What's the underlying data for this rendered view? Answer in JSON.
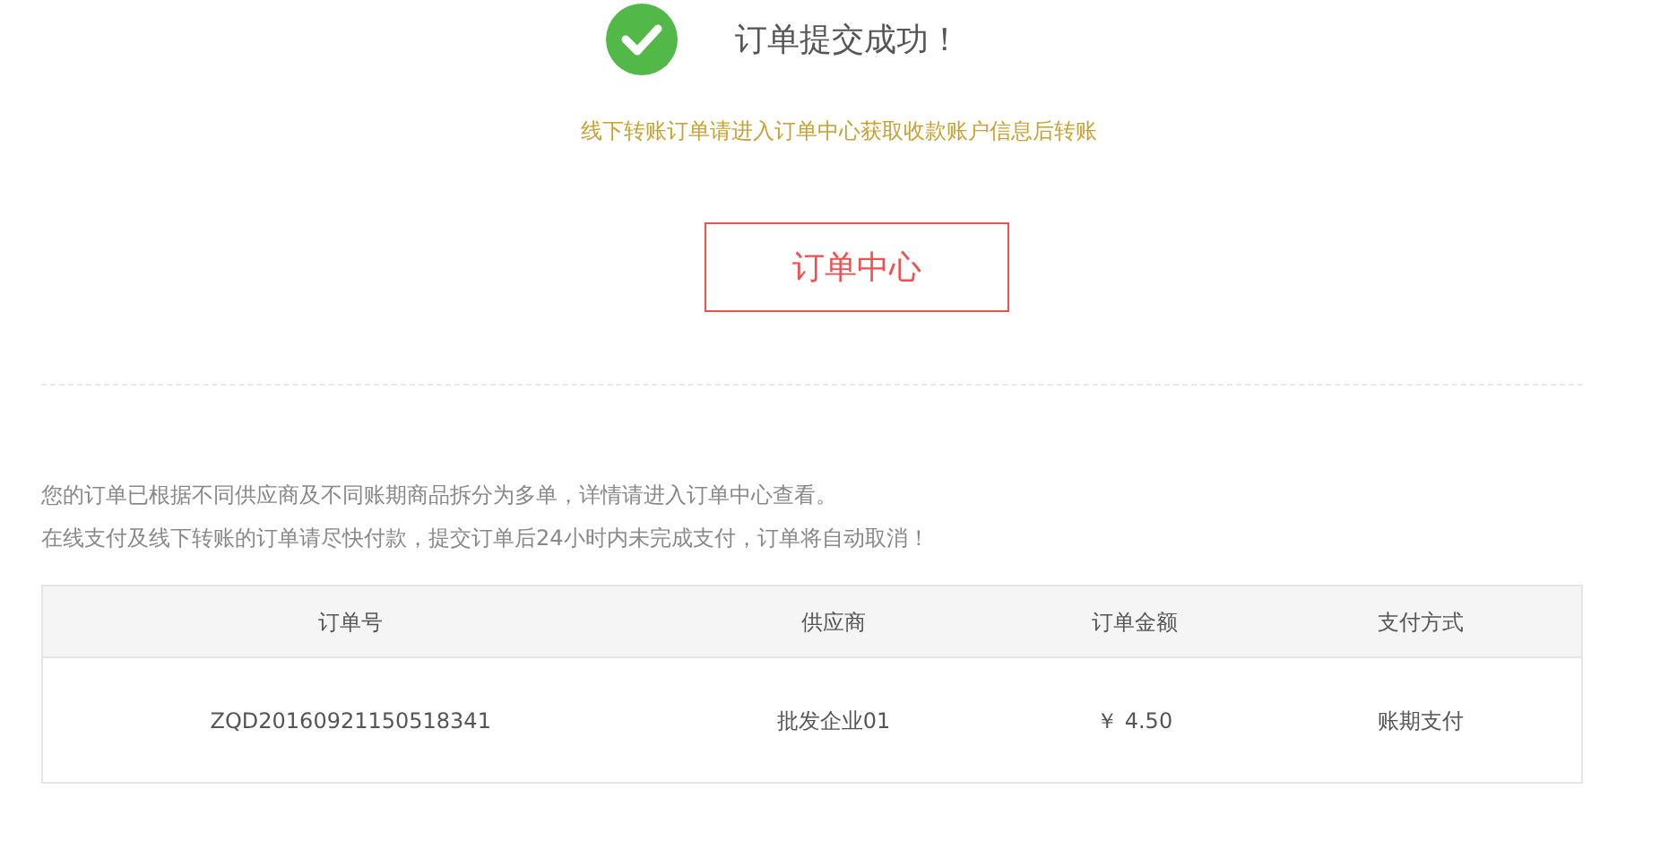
{
  "success": {
    "title": "订单提交成功！",
    "notice": "线下转账订单请进入订单中心获取收款账户信息后转账",
    "button": "订单中心"
  },
  "info": [
    "您的订单已根据不同供应商及不同账期商品拆分为多单，详情请进入订单中心查看。",
    "在线支付及线下转账的订单请尽快付款，提交订单后24小时内未完成支付，订单将自动取消！"
  ],
  "table": {
    "columns": [
      "订单号",
      "供应商",
      "订单金额",
      "支付方式"
    ],
    "rows": [
      [
        "ZQD20160921150518341",
        "批发企业01",
        "￥ 4.50",
        "账期支付"
      ]
    ]
  }
}
